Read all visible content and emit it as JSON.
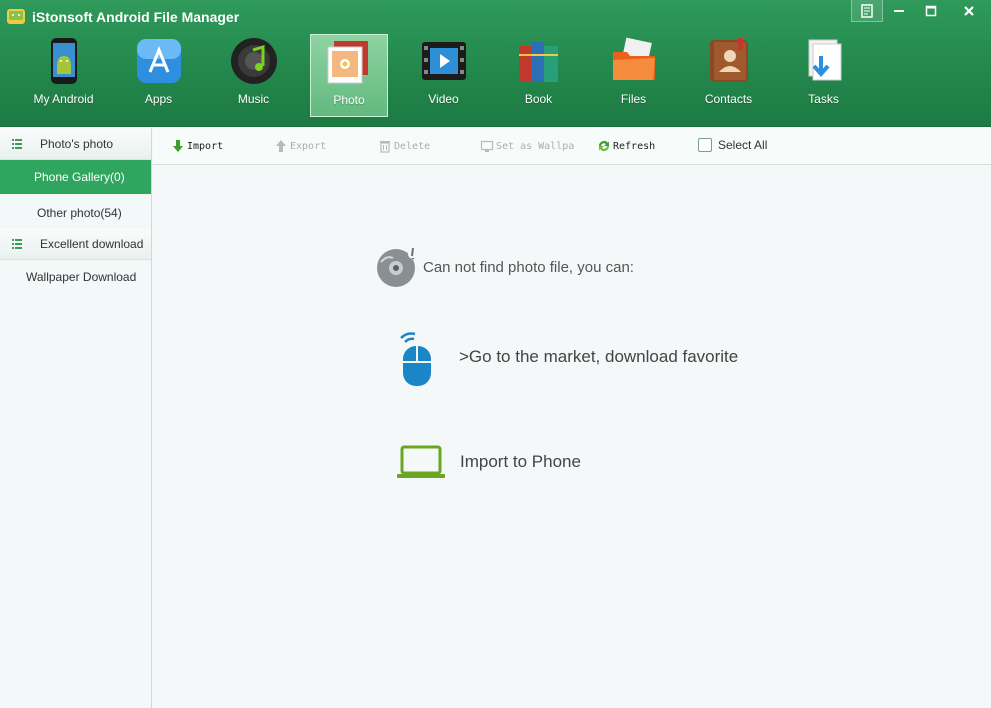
{
  "window": {
    "title": "iStonsoft Android File Manager"
  },
  "window_controls": [
    "feedback-icon",
    "minimize-icon",
    "maximize-icon",
    "close-icon"
  ],
  "nav": [
    {
      "label": "My Android",
      "icon": "android-phone-icon"
    },
    {
      "label": "Apps",
      "icon": "app-store-icon"
    },
    {
      "label": "Music",
      "icon": "music-icon"
    },
    {
      "label": "Photo",
      "icon": "photo-icon",
      "active": true
    },
    {
      "label": "Video",
      "icon": "video-icon"
    },
    {
      "label": "Book",
      "icon": "book-icon"
    },
    {
      "label": "Files",
      "icon": "folder-icon"
    },
    {
      "label": "Contacts",
      "icon": "contacts-icon"
    },
    {
      "label": "Tasks",
      "icon": "tasks-icon"
    }
  ],
  "sidebar": {
    "group1": "Photo's photo",
    "phone_gallery": "Phone Gallery(0)",
    "other_photo": "Other photo(54)",
    "group2": "Excellent download",
    "wallpaper": "Wallpaper Download"
  },
  "toolbar": {
    "import": "Import",
    "export": "Export",
    "delete": "Delete",
    "set_wallpaper": "Set as Wallpa",
    "refresh": "Refresh",
    "select_all": "Select All"
  },
  "main": {
    "empty_message": "Can not find photo file, you can:",
    "market_link": ">Go to the market, download favorite",
    "import_link": "Import to Phone"
  },
  "colors": {
    "header_green": "#23884c",
    "active_green": "#2fa560",
    "accent_blue": "#1a86c8",
    "accent_lime": "#6aa621"
  }
}
